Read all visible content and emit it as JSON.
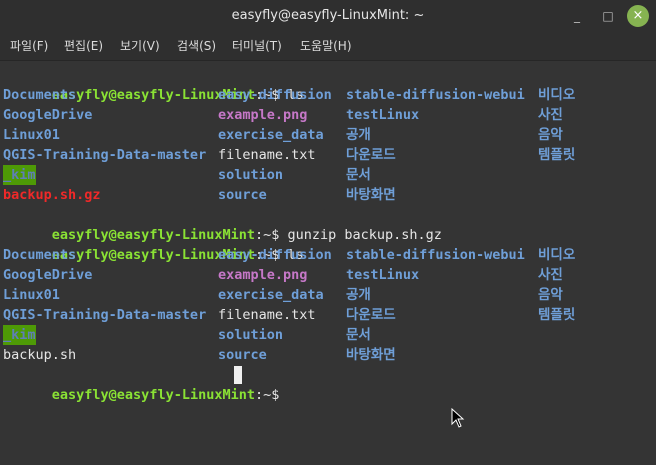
{
  "window": {
    "title": "easyfly@easyfly-LinuxMint: ~"
  },
  "controls": {
    "minimize": "_",
    "maximize": "□",
    "close": "×"
  },
  "menu": [
    "파일(F)",
    "편집(E)",
    "보기(V)",
    "검색(S)",
    "터미널(T)",
    "도움말(H)"
  ],
  "prompt": {
    "user": "easyfly@easyfly-LinuxMint",
    "suffix": ":~$ "
  },
  "commands": [
    "ls",
    "gunzip backup.sh.gz",
    "ls",
    ""
  ],
  "listing1": [
    [
      [
        "Documents",
        "dir"
      ],
      [
        "easy-diffusion",
        "dir"
      ],
      [
        "stable-diffusion-webui",
        "dir"
      ],
      [
        "비디오",
        "dir"
      ]
    ],
    [
      [
        "GoogleDrive",
        "dir"
      ],
      [
        "example.png",
        "img"
      ],
      [
        "testLinux",
        "dir"
      ],
      [
        "사진",
        "dir"
      ]
    ],
    [
      [
        "Linux01",
        "dir"
      ],
      [
        "exercise_data",
        "dir"
      ],
      [
        "공개",
        "dir"
      ],
      [
        "음악",
        "dir"
      ]
    ],
    [
      [
        "QGIS-Training-Data-master",
        "dir"
      ],
      [
        "filename.txt",
        "plain"
      ],
      [
        "다운로드",
        "dir"
      ],
      [
        "템플릿",
        "dir"
      ]
    ],
    [
      [
        "_kim",
        "hl"
      ],
      [
        "solution",
        "dir"
      ],
      [
        "문서",
        "dir"
      ],
      [
        "",
        ""
      ]
    ],
    [
      [
        "backup.sh.gz",
        "arch"
      ],
      [
        "source",
        "dir"
      ],
      [
        "바탕화면",
        "dir"
      ],
      [
        "",
        ""
      ]
    ]
  ],
  "listing2": [
    [
      [
        "Documents",
        "dir"
      ],
      [
        "easy-diffusion",
        "dir"
      ],
      [
        "stable-diffusion-webui",
        "dir"
      ],
      [
        "비디오",
        "dir"
      ]
    ],
    [
      [
        "GoogleDrive",
        "dir"
      ],
      [
        "example.png",
        "img"
      ],
      [
        "testLinux",
        "dir"
      ],
      [
        "사진",
        "dir"
      ]
    ],
    [
      [
        "Linux01",
        "dir"
      ],
      [
        "exercise_data",
        "dir"
      ],
      [
        "공개",
        "dir"
      ],
      [
        "음악",
        "dir"
      ]
    ],
    [
      [
        "QGIS-Training-Data-master",
        "dir"
      ],
      [
        "filename.txt",
        "plain"
      ],
      [
        "다운로드",
        "dir"
      ],
      [
        "템플릿",
        "dir"
      ]
    ],
    [
      [
        "_kim",
        "hl"
      ],
      [
        "solution",
        "dir"
      ],
      [
        "문서",
        "dir"
      ],
      [
        "",
        ""
      ]
    ],
    [
      [
        "backup.sh",
        "plain"
      ],
      [
        "source",
        "dir"
      ],
      [
        "바탕화면",
        "dir"
      ],
      [
        "",
        ""
      ]
    ]
  ]
}
